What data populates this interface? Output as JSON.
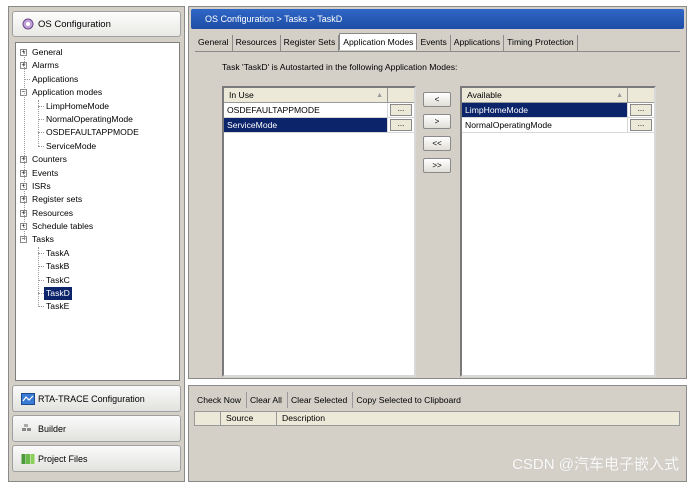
{
  "left_panel": {
    "title": "OS Configuration",
    "tree": [
      {
        "label": "General",
        "level": 0,
        "expander": "+"
      },
      {
        "label": "Alarms",
        "level": 0,
        "expander": "+"
      },
      {
        "label": "Applications",
        "level": 0,
        "expander": ""
      },
      {
        "label": "Application modes",
        "level": 0,
        "expander": "-"
      },
      {
        "label": "LimpHomeMode",
        "level": 1,
        "expander": ""
      },
      {
        "label": "NormalOperatingMode",
        "level": 1,
        "expander": ""
      },
      {
        "label": "OSDEFAULTAPPMODE",
        "level": 1,
        "expander": ""
      },
      {
        "label": "ServiceMode",
        "level": 1,
        "expander": ""
      },
      {
        "label": "Counters",
        "level": 0,
        "expander": "+"
      },
      {
        "label": "Events",
        "level": 0,
        "expander": "+"
      },
      {
        "label": "ISRs",
        "level": 0,
        "expander": "+"
      },
      {
        "label": "Register sets",
        "level": 0,
        "expander": "+"
      },
      {
        "label": "Resources",
        "level": 0,
        "expander": "+"
      },
      {
        "label": "Schedule tables",
        "level": 0,
        "expander": "+"
      },
      {
        "label": "Tasks",
        "level": 0,
        "expander": "-"
      },
      {
        "label": "TaskA",
        "level": 1,
        "expander": ""
      },
      {
        "label": "TaskB",
        "level": 1,
        "expander": ""
      },
      {
        "label": "TaskC",
        "level": 1,
        "expander": ""
      },
      {
        "label": "TaskD",
        "level": 1,
        "expander": "",
        "selected": true
      },
      {
        "label": "TaskE",
        "level": 1,
        "expander": ""
      }
    ],
    "nav_buttons": [
      {
        "label": "RTA-TRACE Configuration",
        "icon": "trace-icon"
      },
      {
        "label": "Builder",
        "icon": "builder-icon"
      },
      {
        "label": "Project Files",
        "icon": "project-files-icon"
      }
    ]
  },
  "breadcrumb": "OS Configuration  >  Tasks  >  TaskD",
  "tabs": [
    {
      "label": "General"
    },
    {
      "label": "Resources"
    },
    {
      "label": "Register Sets"
    },
    {
      "label": "Application Modes",
      "active": true
    },
    {
      "label": "Events"
    },
    {
      "label": "Applications"
    },
    {
      "label": "Timing Protection"
    }
  ],
  "app_modes": {
    "description": "Task 'TaskD' is Autostarted in the following Application Modes:",
    "in_use": {
      "header": "In Use",
      "rows": [
        {
          "name": "OSDEFAULTAPPMODE",
          "selected": false
        },
        {
          "name": "ServiceMode",
          "selected": true
        }
      ]
    },
    "available": {
      "header": "Available",
      "rows": [
        {
          "name": "LimpHomeMode",
          "selected": true
        },
        {
          "name": "NormalOperatingMode",
          "selected": false
        }
      ]
    },
    "ellipsis_label": "...",
    "move_buttons": [
      "<",
      ">",
      "<<",
      ">>"
    ]
  },
  "check_panel": {
    "toolbar": [
      "Check Now",
      "Clear All",
      "Clear Selected",
      "Copy Selected to Clipboard"
    ],
    "columns": [
      "",
      "Source",
      "Description"
    ]
  },
  "watermark": "CSDN @汽车电子嵌入式",
  "colors": {
    "selection": "#0b246a",
    "breadcrumb": "#1e4ea6",
    "panel": "#d4d0c8"
  }
}
